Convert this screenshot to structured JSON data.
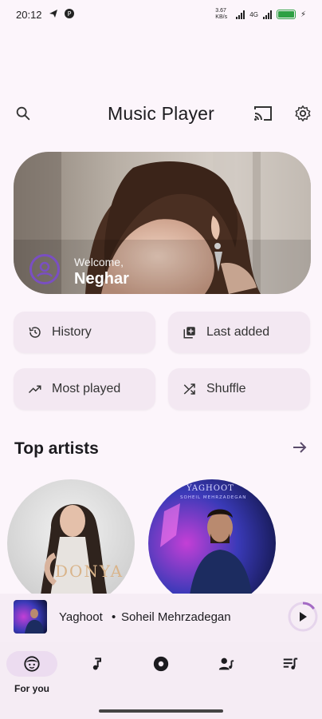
{
  "status_bar": {
    "time": "20:12",
    "net_speed": "3.67 KB/s",
    "net_type": "4G",
    "battery_level": 1.0
  },
  "header": {
    "title": "Music Player"
  },
  "hero": {
    "welcome": "Welcome,",
    "name": "Neghar"
  },
  "quick_actions": [
    {
      "label": "History",
      "icon": "history-icon"
    },
    {
      "label": "Last added",
      "icon": "library-add-icon"
    },
    {
      "label": "Most played",
      "icon": "trending-up-icon"
    },
    {
      "label": "Shuffle",
      "icon": "shuffle-icon"
    }
  ],
  "top_artists": {
    "title": "Top artists",
    "artists": [
      {
        "cover_text": "DONYA",
        "cover_subtext": ""
      },
      {
        "cover_text": "YAGHOOT",
        "cover_subtext": "SOHEIL MEHRZADEGAN"
      }
    ]
  },
  "mini_player": {
    "title": "Yaghoot",
    "separator": "•",
    "artist": "Soheil Mehrzadegan",
    "progress": 0.15
  },
  "bottom_nav": {
    "items": [
      {
        "label": "For you",
        "icon": "for-you-icon",
        "active": true
      },
      {
        "label": "",
        "icon": "songs-icon",
        "active": false
      },
      {
        "label": "",
        "icon": "albums-icon",
        "active": false
      },
      {
        "label": "",
        "icon": "artists-icon",
        "active": false
      },
      {
        "label": "",
        "icon": "playlists-icon",
        "active": false
      }
    ]
  },
  "colors": {
    "background": "#fcf5fb",
    "accent": "#7a4fc2",
    "chip": "#f3e8f2",
    "nav_active": "#ecdcf0"
  }
}
